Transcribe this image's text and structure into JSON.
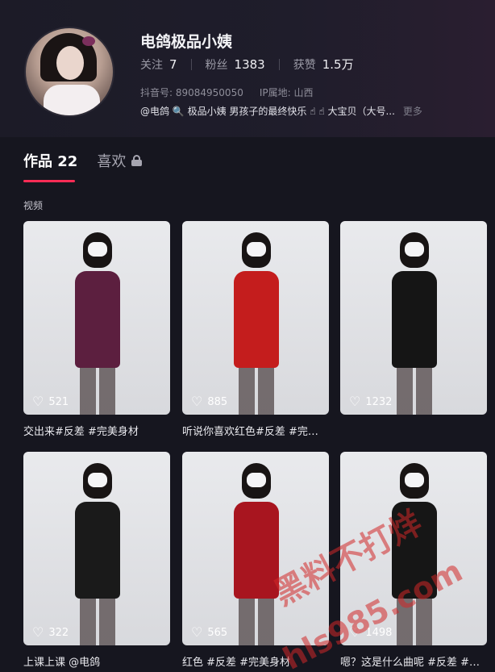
{
  "profile": {
    "username": "电鸽极品小姨",
    "stats": [
      {
        "label": "关注",
        "value": "7"
      },
      {
        "label": "粉丝",
        "value": "1383"
      },
      {
        "label": "获赞",
        "value": "1.5万"
      }
    ],
    "douyin_id": "抖音号: 89084950050",
    "ip_location": "IP属地: 山西",
    "bio": "@电鸽 🔍 极品小姨 男孩子的最终快乐 ☝ ☝ 大宝贝（大号...",
    "bio_more": "更多"
  },
  "tabs": {
    "works": "作品 22",
    "likes": "喜欢"
  },
  "section_label": "视频",
  "videos": [
    {
      "likes": "521",
      "caption": "交出来#反差 #完美身材",
      "outfit": "#5c1f3f"
    },
    {
      "likes": "885",
      "caption": "听说你喜欢红色#反差 #完…",
      "outfit": "#c41d1d"
    },
    {
      "likes": "1232",
      "caption": "",
      "outfit": "#151515"
    },
    {
      "likes": "322",
      "caption": "上课上课 @电鸽",
      "outfit": "#1a1a1a"
    },
    {
      "likes": "565",
      "caption": "红色 #反差 #完美身材",
      "outfit": "#a8151f"
    },
    {
      "likes": "1498",
      "caption": "嗯？这是什么曲呢 #反差 #…",
      "outfit": "#161616"
    }
  ],
  "watermark": {
    "line1": "黑料不打烊",
    "line2": "hls985.com"
  },
  "colors": {
    "accent": "#fe2c55",
    "background": "#16161f"
  }
}
